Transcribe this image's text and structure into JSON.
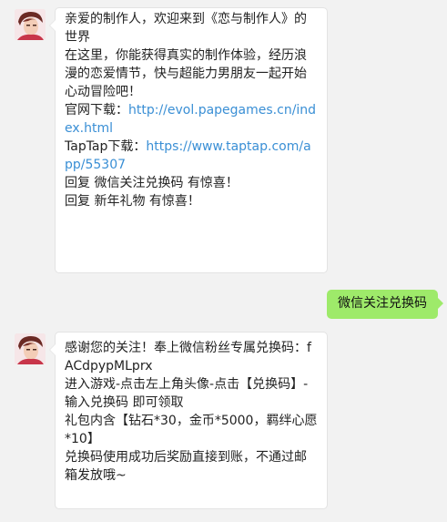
{
  "avatar_icon": "game-character-avatar",
  "message1": {
    "lines": [
      {
        "text": "亲爱的制作人，欢迎来到《恋与制作人》的世界"
      },
      {
        "text": "在这里，你能获得真实的制作体验，经历浪漫的恋爱情节，快与超能力男朋友一起开始心动冒险吧！"
      }
    ],
    "official_label": "官网下载：",
    "official_url": "http://evol.papegames.cn/index.html",
    "taptap_label": "TapTap下载：",
    "taptap_url": "https://www.taptap.com/app/55307",
    "reply1": "回复 微信关注兑换码 有惊喜！",
    "reply2": "回复 新年礼物 有惊喜！"
  },
  "sent_message": "微信关注兑换码",
  "message2": {
    "line1": "感谢您的关注！奉上微信粉丝专属兑换码：fACdpypMLprx",
    "line2": "进入游戏-点击左上角头像-点击【兑换码】-输入兑换码 即可领取",
    "line3": "礼包内含【钻石*30，金币*5000，羁绊心愿*10】",
    "line4": "兑换码使用成功后奖励直接到账，不通过邮箱发放哦~"
  }
}
